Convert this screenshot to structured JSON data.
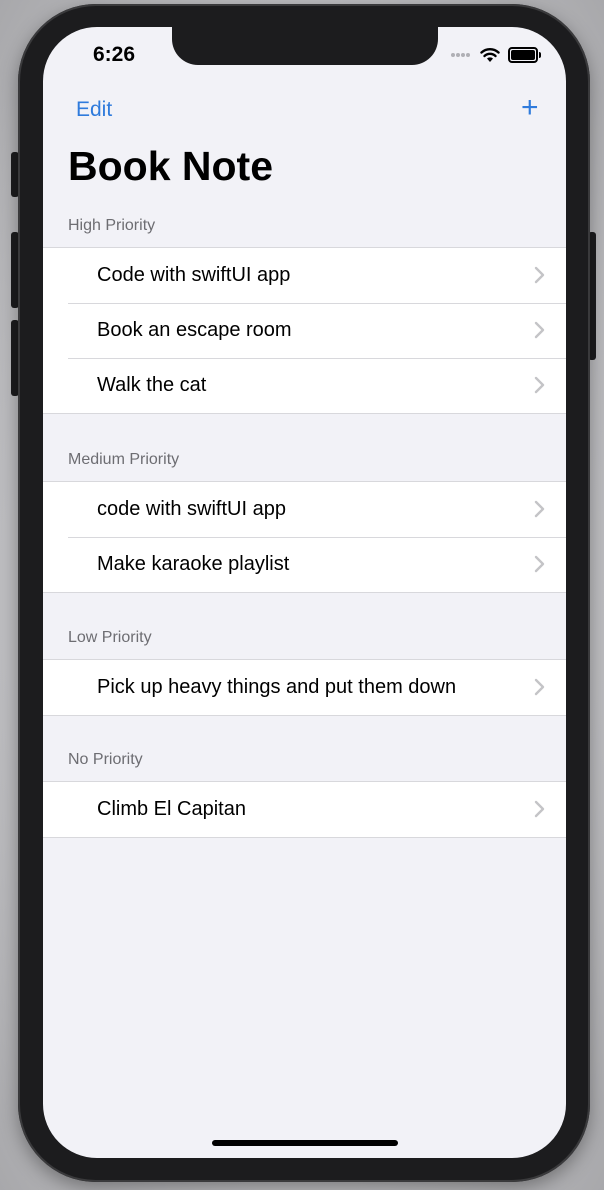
{
  "status_bar": {
    "time": "6:26",
    "cellular_icon": "cellular-dots-icon",
    "wifi_icon": "wifi-icon",
    "battery_icon": "battery-icon"
  },
  "nav": {
    "edit_label": "Edit",
    "add_label": "+",
    "title": "Book Note"
  },
  "sections": [
    {
      "header": "High Priority",
      "items": [
        "Code with swiftUI app",
        "Book an escape room",
        "Walk the cat"
      ]
    },
    {
      "header": "Medium Priority",
      "items": [
        "code with swiftUI app",
        "Make karaoke playlist"
      ]
    },
    {
      "header": "Low Priority",
      "items": [
        "Pick up heavy things and put them down"
      ]
    },
    {
      "header": "No Priority",
      "items": [
        "Climb El Capitan"
      ]
    }
  ],
  "colors": {
    "accent": "#2f7bdc",
    "background": "#f2f2f7",
    "secondary_text": "#6d6d72"
  }
}
